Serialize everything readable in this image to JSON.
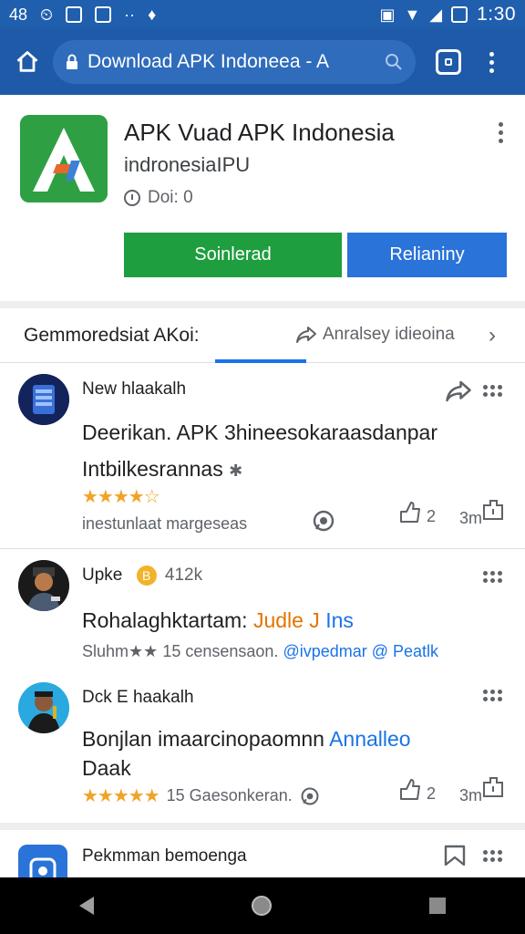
{
  "status_bar": {
    "left_text": "48",
    "time": "1:30"
  },
  "browser": {
    "url_text": "Download APK Indoneea - A"
  },
  "app": {
    "title": "APK Vuad APK Indonesia",
    "developer": "indronesiaIPU",
    "downloads": "Doi: 0",
    "primary_button": "Soinlerad",
    "secondary_button": "Relianiny"
  },
  "tabs": {
    "main_label": "Gemmoredsiat AKoi:",
    "share_label": "Anralsey idieoina"
  },
  "reviews": [
    {
      "name": "New hlaakalh",
      "text_line1": "Deerikan. APK 3hineesokaraasdanpar",
      "text_line2": "Intbilkesrannas",
      "stars": "★★★★☆",
      "meta": "inestunlaat margeseas",
      "like_count": "2",
      "reply_label": "3m"
    },
    {
      "name": "Upke",
      "badge": "412k",
      "text_plain": "Rohalaghktartam:",
      "text_accent": "Judle J",
      "text_link": "Ins",
      "meta_stars": "Sluhm★★",
      "meta_text": "15 censensaon.",
      "meta_link": "@ivpedmar @ Peatlk"
    },
    {
      "name": "Dck E haakalh",
      "text_line1_plain": "Bonjlan imaarcinopaomnn",
      "text_line1_link": "Annalleo",
      "text_line2": "Daak",
      "stars": "★★★★★",
      "meta": "15 Gaesonkeran.",
      "like_count": "2",
      "reply_label": "3m"
    },
    {
      "name": "Pekmman bemoenga"
    }
  ],
  "colors": {
    "toolbar": "#1e5aa8",
    "download_button": "#1e9e3e",
    "secondary_button": "#2a73d8",
    "star": "#f1a325",
    "link": "#1a73e8"
  }
}
